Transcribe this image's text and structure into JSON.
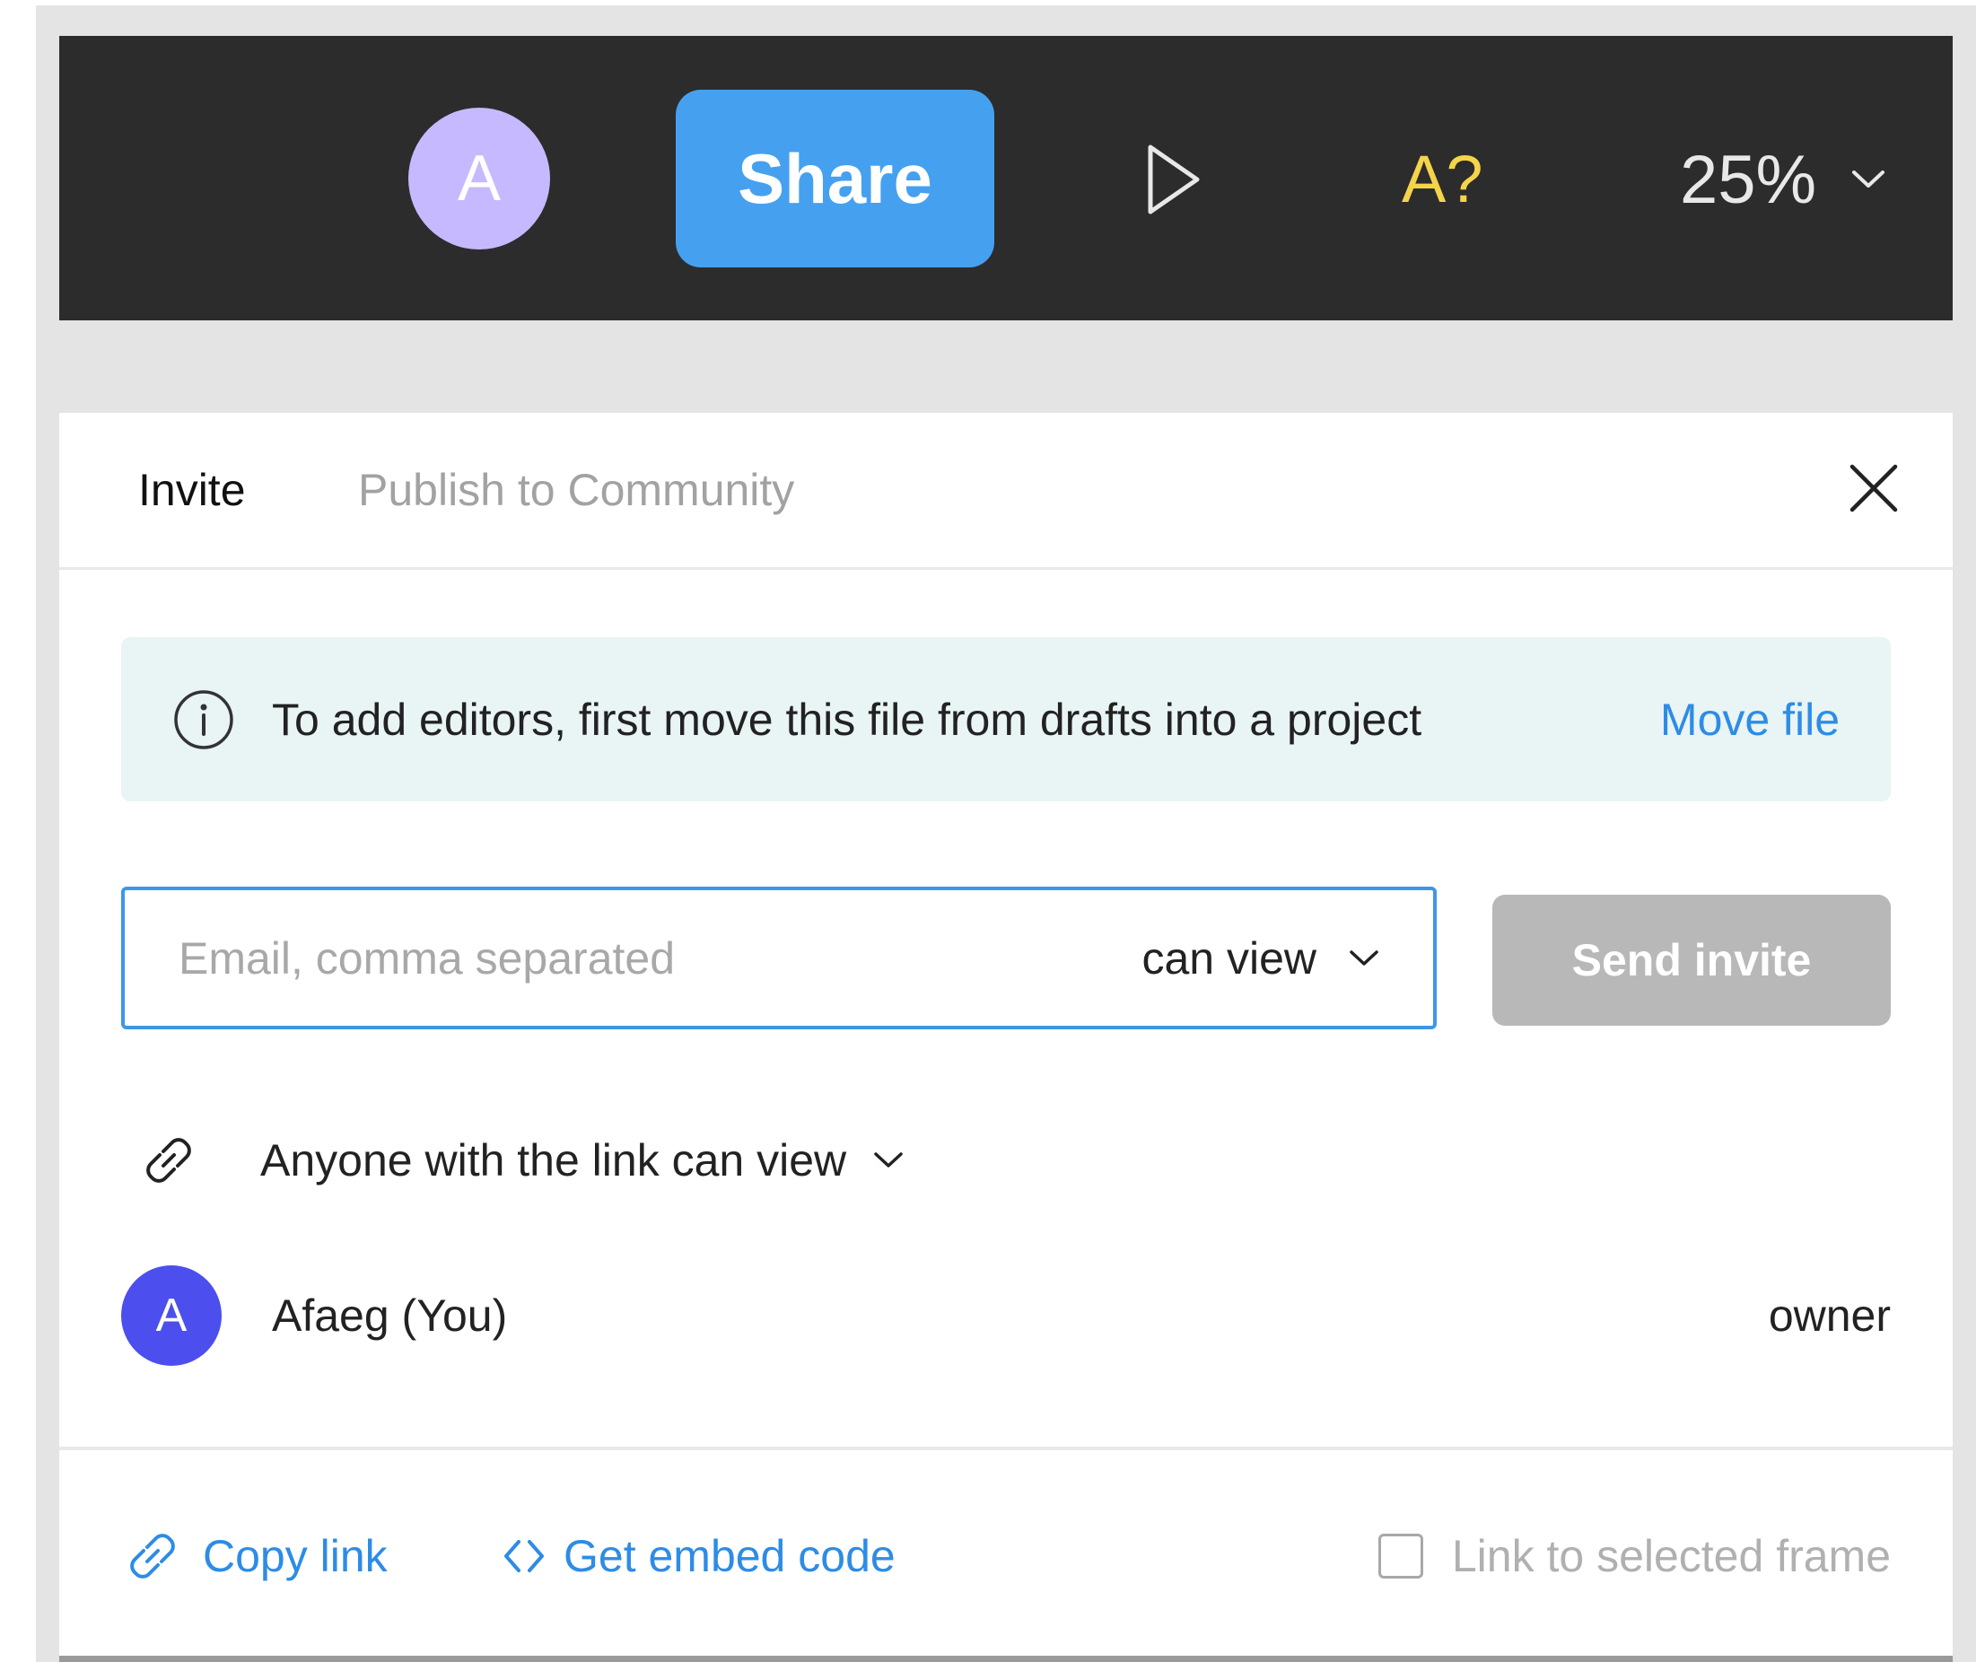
{
  "toolbar": {
    "avatar_initial": "A",
    "share_label": "Share",
    "font_check_label": "A?",
    "zoom_value": "25%",
    "colors": {
      "background": "#2c2c2c",
      "share": "#45a1f0",
      "avatar": "#c7b9ff",
      "font_check": "#f5d44a"
    }
  },
  "dialog": {
    "tabs": [
      {
        "label": "Invite",
        "active": true
      },
      {
        "label": "Publish to Community",
        "active": false
      }
    ],
    "banner": {
      "message": "To add editors, first move this file from drafts into a project",
      "action_label": "Move file"
    },
    "invite": {
      "email_placeholder": "Email, comma separated",
      "email_value": "",
      "role_value": "can view",
      "send_label": "Send invite"
    },
    "link_access": {
      "label": "Anyone with the link can view"
    },
    "members": [
      {
        "initial": "A",
        "name": "Afaeg (You)",
        "role": "owner"
      }
    ],
    "footer": {
      "copy_link_label": "Copy link",
      "embed_label": "Get embed code",
      "frame_link_label": "Link to selected frame",
      "frame_link_checked": false
    }
  }
}
